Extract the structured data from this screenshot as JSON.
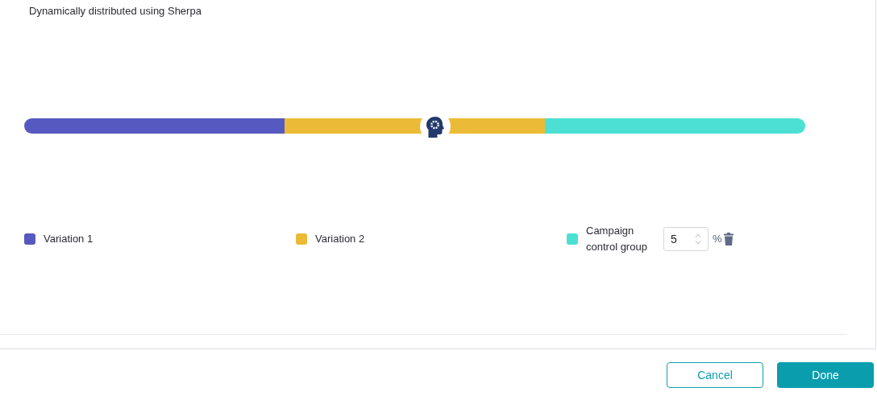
{
  "subtitle": "Dynamically distributed using Sherpa",
  "variations": [
    {
      "label": "Variation 1",
      "color": "#5659bf",
      "kind": "plain"
    },
    {
      "label": "Variation 2",
      "color": "#ebbb37",
      "kind": "plain"
    },
    {
      "label": "Campaign control group",
      "color": "#4ce0d4",
      "kind": "control",
      "value": "5",
      "unit": "%"
    }
  ],
  "buttons": [
    {
      "label": "Cancel",
      "kind": "secondary"
    },
    {
      "label": "Done",
      "kind": "primary"
    }
  ]
}
